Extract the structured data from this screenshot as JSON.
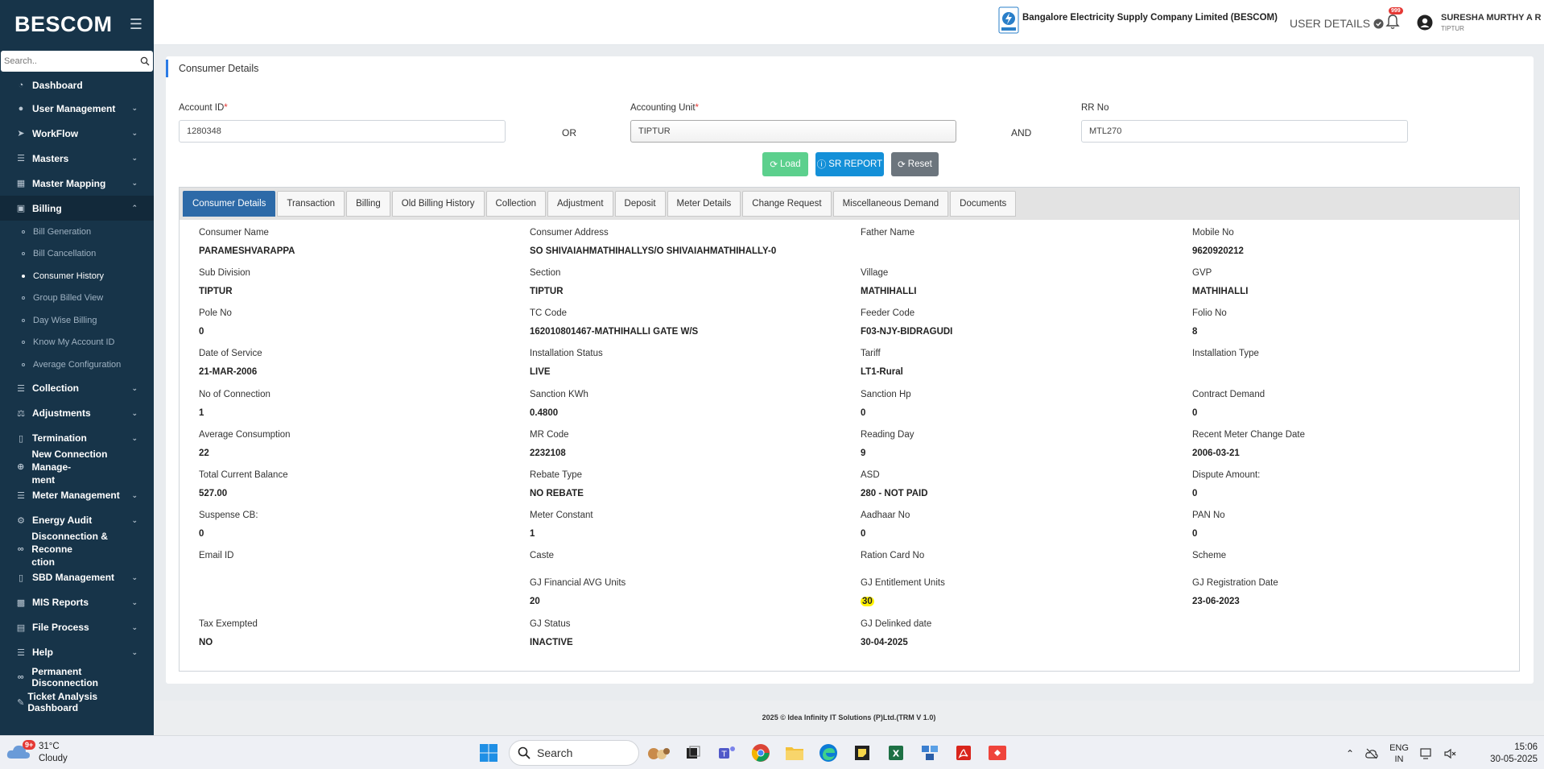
{
  "sidebar": {
    "brand": "BESCOM",
    "search_placeholder": "Search..",
    "items": [
      {
        "label": "Dashboard"
      },
      {
        "label": "User Management"
      },
      {
        "label": "WorkFlow"
      },
      {
        "label": "Masters"
      },
      {
        "label": "Master Mapping"
      },
      {
        "label": "Billing"
      },
      {
        "label": "Collection"
      },
      {
        "label": "Adjustments"
      },
      {
        "label": "Termination"
      },
      {
        "label": "New Connection Manage-",
        "label2": "ment"
      },
      {
        "label": "Meter Management"
      },
      {
        "label": "Energy Audit"
      },
      {
        "label": "Disconnection & Reconne",
        "label2": "ction"
      },
      {
        "label": "SBD Management"
      },
      {
        "label": "MIS Reports"
      },
      {
        "label": "File Process"
      },
      {
        "label": "Help"
      },
      {
        "label": "Permanent Disconnection"
      },
      {
        "label": "Ticket Analysis Dashboard"
      }
    ],
    "billing_sub": [
      "Bill Generation",
      "Bill Cancellation",
      "Consumer History",
      "Group Billed View",
      "Day Wise Billing",
      "Know My Account ID",
      "Average Configuration"
    ]
  },
  "header": {
    "company": "Bangalore Electricity Supply Company Limited (BESCOM)",
    "user_details": "USER DETAILS",
    "notif_count": "999",
    "user_name": "SURESHA MURTHY A R",
    "user_location": "TIPTUR"
  },
  "form": {
    "title": "Consumer Details",
    "account_id_label": "Account ID",
    "account_id_value": "1280348",
    "or_label": "OR",
    "accounting_unit_label": "Accounting Unit",
    "accounting_unit_value": "TIPTUR",
    "and_label": "AND",
    "rr_label": "RR No",
    "rr_value": "MTL270",
    "required_mark": "*",
    "load_label": "Load",
    "sr_label": "SR REPORT",
    "reset_label": "Reset"
  },
  "tabs": [
    "Consumer Details",
    "Transaction",
    "Billing",
    "Old Billing History",
    "Collection",
    "Adjustment",
    "Deposit",
    "Meter Details",
    "Change Request",
    "Miscellaneous Demand",
    "Documents"
  ],
  "details": {
    "r1": [
      {
        "label": "Consumer Name",
        "value": "PARAMESHVARAPPA"
      },
      {
        "label": "Consumer Address",
        "value": "SO SHIVAIAHMATHIHALLYS/O SHIVAIAHMATHIHALLY-0"
      },
      {
        "label": "Father Name",
        "value": ""
      },
      {
        "label": "Mobile No",
        "value": "9620920212"
      }
    ],
    "r2": [
      {
        "label": "Sub Division",
        "value": "TIPTUR"
      },
      {
        "label": "Section",
        "value": "TIPTUR"
      },
      {
        "label": "Village",
        "value": "MATHIHALLI"
      },
      {
        "label": "GVP",
        "value": "MATHIHALLI"
      }
    ],
    "r3": [
      {
        "label": "Pole No",
        "value": "0"
      },
      {
        "label": "TC Code",
        "value": "162010801467-MATHIHALLI GATE W/S"
      },
      {
        "label": "Feeder Code",
        "value": "F03-NJY-BIDRAGUDI"
      },
      {
        "label": "Folio No",
        "value": "8"
      }
    ],
    "r4": [
      {
        "label": "Date of Service",
        "value": "21-MAR-2006"
      },
      {
        "label": "Installation Status",
        "value": "LIVE"
      },
      {
        "label": "Tariff",
        "value": "LT1-Rural"
      },
      {
        "label": "Installation Type",
        "value": ""
      }
    ],
    "r5": [
      {
        "label": "No of Connection",
        "value": "1"
      },
      {
        "label": "Sanction KWh",
        "value": "0.4800"
      },
      {
        "label": "Sanction Hp",
        "value": "0"
      },
      {
        "label": "Contract Demand",
        "value": "0"
      }
    ],
    "r6": [
      {
        "label": "Average Consumption",
        "value": "22"
      },
      {
        "label": "MR Code",
        "value": "2232108"
      },
      {
        "label": "Reading Day",
        "value": "9"
      },
      {
        "label": "Recent Meter Change Date",
        "value": "2006-03-21"
      }
    ],
    "r7": [
      {
        "label": "Total Current Balance",
        "value": "527.00"
      },
      {
        "label": "Rebate Type",
        "value": "NO REBATE"
      },
      {
        "label": "ASD",
        "value": "280 - NOT PAID"
      },
      {
        "label": "Dispute Amount:",
        "value": "0"
      }
    ],
    "r8": [
      {
        "label": "Suspense CB:",
        "value": "0"
      },
      {
        "label": "Meter Constant",
        "value": "1"
      },
      {
        "label": "Aadhaar No",
        "value": "0"
      },
      {
        "label": "PAN No",
        "value": "0"
      }
    ],
    "r9": [
      {
        "label": "Email ID",
        "value": ""
      },
      {
        "label": "Caste",
        "value": ""
      },
      {
        "label": "Ration Card No",
        "value": ""
      },
      {
        "label": "Scheme",
        "value": ""
      }
    ],
    "r10": [
      {
        "label": "GJ Financial AVG Units",
        "value": "20"
      },
      {
        "label": "GJ Entitlement Units",
        "value": "30"
      },
      {
        "label": "GJ Registration Date",
        "value": "23-06-2023"
      }
    ],
    "r11": [
      {
        "label": "Tax Exempted",
        "value": "NO"
      },
      {
        "label": "GJ Status",
        "value": "INACTIVE"
      },
      {
        "label": "GJ Delinked date",
        "value": "30-04-2025"
      }
    ]
  },
  "footer": "2025 © Idea Infinity IT Solutions (P)Ltd.(TRM V 1.0)",
  "taskbar": {
    "weather_temp": "31°C",
    "weather_desc": "Cloudy",
    "weather_badge": "9+",
    "search_label": "Search",
    "lang1": "ENG",
    "lang2": "IN",
    "time": "15:06",
    "date": "30-05-2025"
  }
}
